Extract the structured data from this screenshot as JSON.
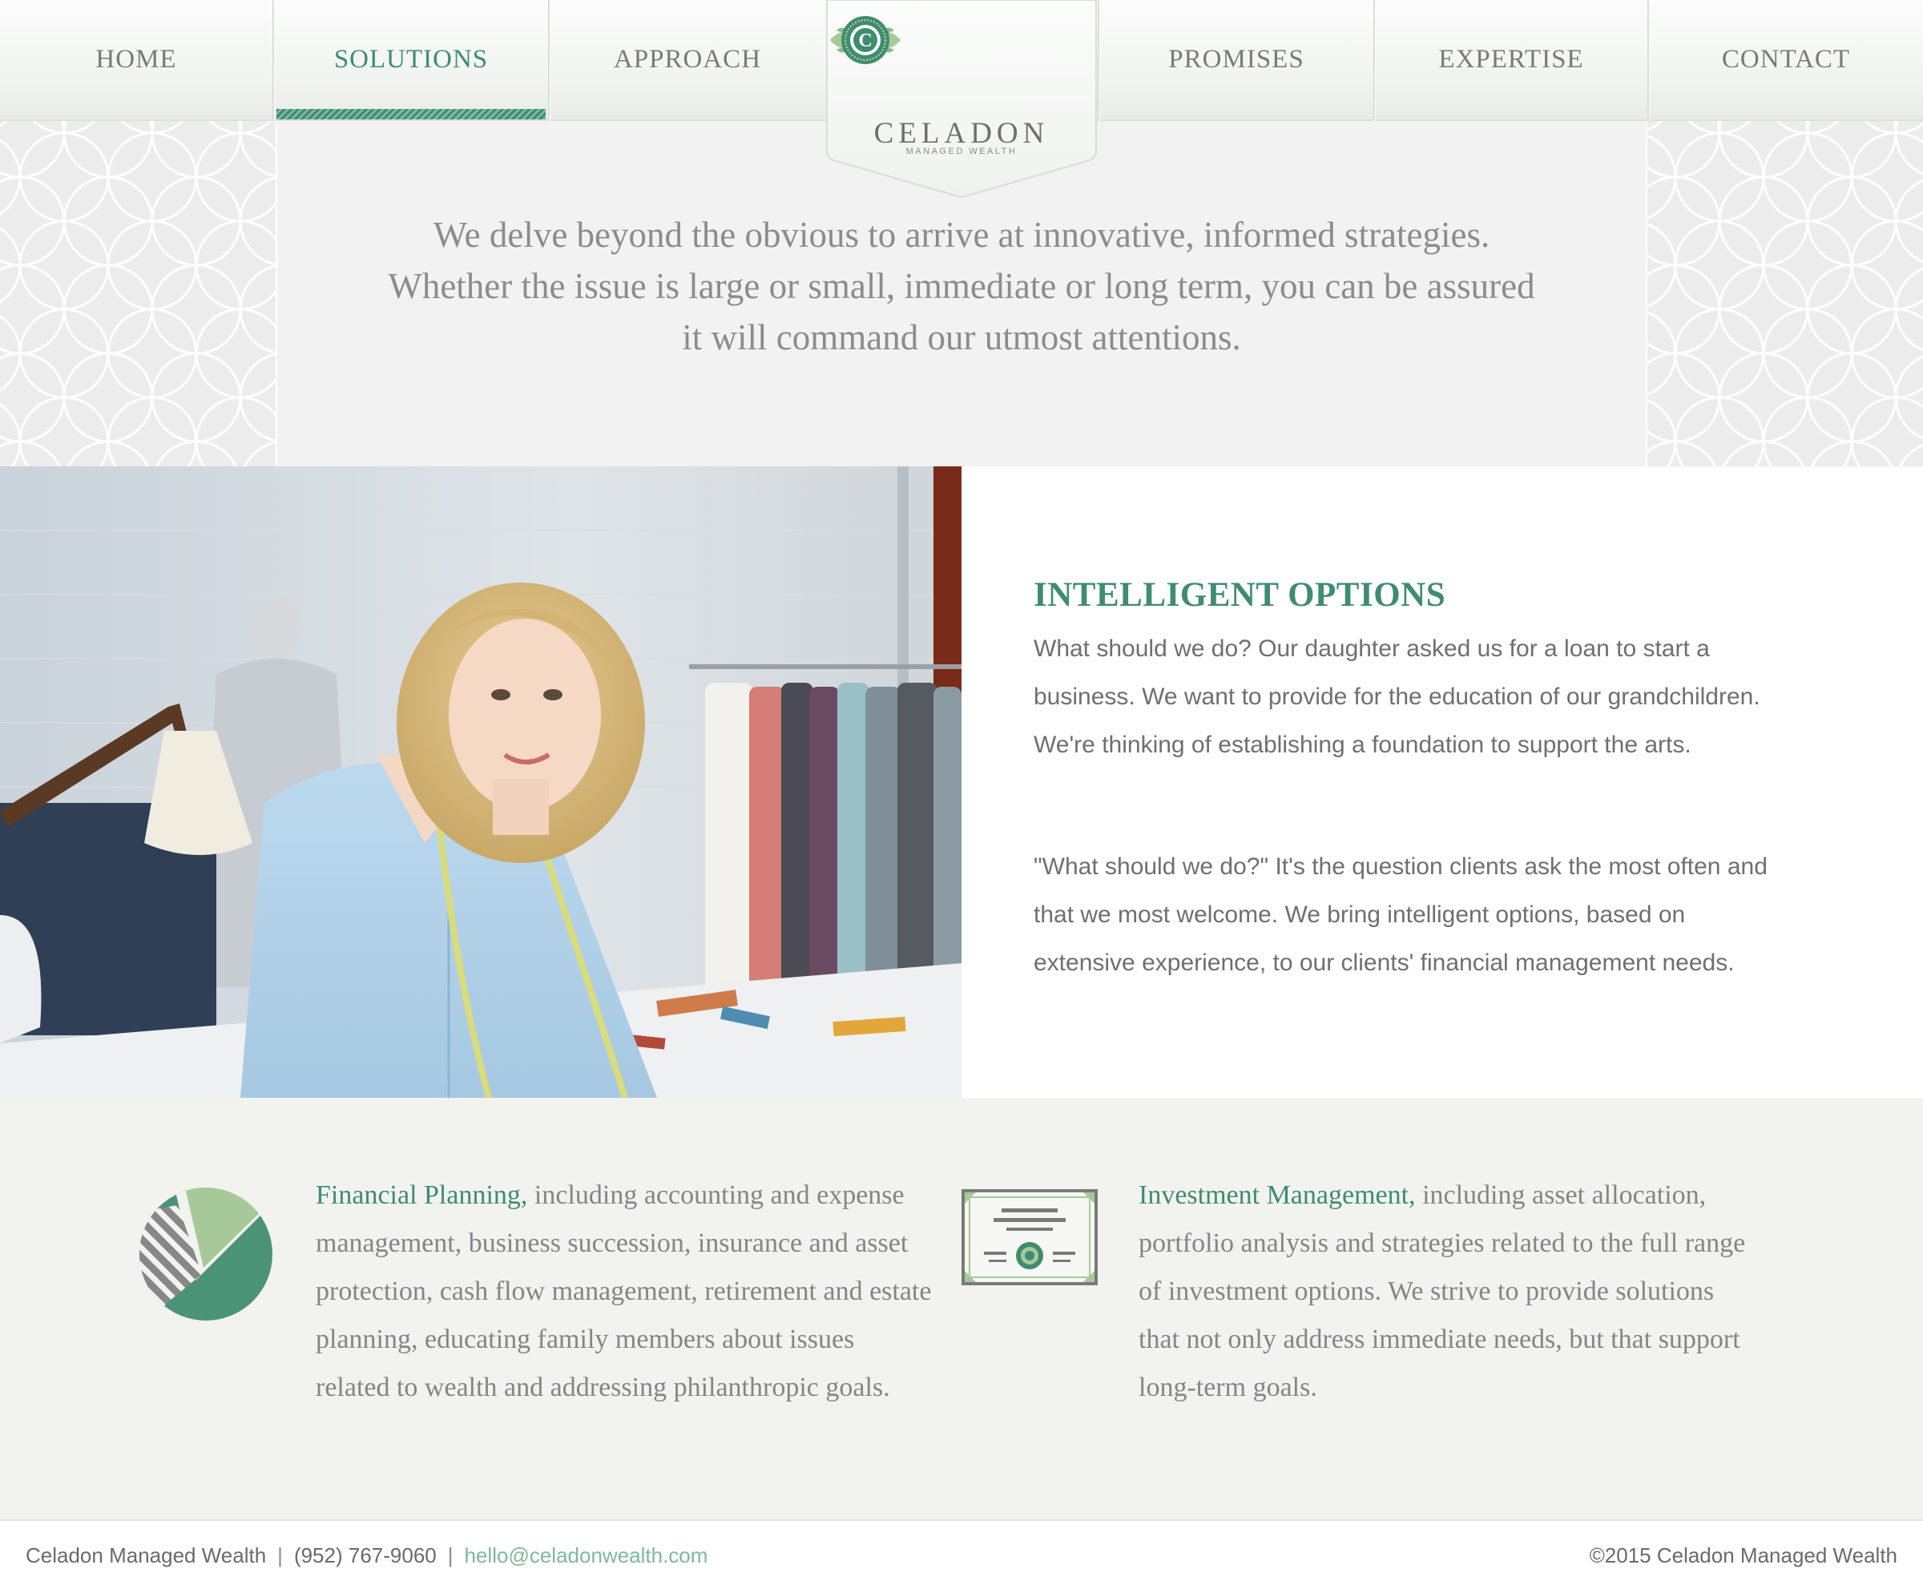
{
  "nav": {
    "items": [
      {
        "label": "HOME"
      },
      {
        "label": "SOLUTIONS"
      },
      {
        "label": "APPROACH"
      },
      {
        "label": "PROMISES"
      },
      {
        "label": "EXPERTISE"
      },
      {
        "label": "CONTACT"
      }
    ],
    "active": "SOLUTIONS"
  },
  "logo": {
    "name": "CELADON",
    "tagline": "MANAGED WEALTH",
    "icon": "c-monogram-seal-icon"
  },
  "intro": {
    "text": "We delve beyond the obvious to arrive at innovative, informed strategies. Whether the issue is large or small, immediate or long term, you can be assured it will command our utmost attentions."
  },
  "feature": {
    "image": "woman-in-clothing-studio-photo",
    "title": "INTELLIGENT OPTIONS",
    "paragraph1": "What should we do? Our daughter asked us for a loan to start a business. We want to provide for the education of our grandchildren. We're thinking of establishing a foundation to support the arts.",
    "paragraph2": "\"What should we do?\" It's the question clients ask the most often and that we most welcome. We bring intelligent options, based on extensive experience, to our clients' financial management needs."
  },
  "services": [
    {
      "icon": "pie-chart-icon",
      "lead": "Financial Planning,",
      "text": " including accounting and expense management, business succession, insurance and asset protection, cash flow management, retirement and estate planning, educating family members about issues related to wealth and addressing philanthropic goals."
    },
    {
      "icon": "certificate-icon",
      "lead": "Investment Management,",
      "text": " including asset allocation, portfolio analysis and strategies related to the full range of investment options. We strive to provide solutions that not only address immediate needs, but that support long-term goals."
    }
  ],
  "footer": {
    "company": "Celadon Managed Wealth",
    "separator": "|",
    "phone": "(952) 767-9060",
    "email": "hello@celadonwealth.com",
    "copyright": "©2015 Celadon Managed Wealth"
  },
  "colors": {
    "accent": "#3f8c6f",
    "accent_light": "#a7c99a",
    "text": "#6f6f6f",
    "email_link": "#7fb89a"
  }
}
